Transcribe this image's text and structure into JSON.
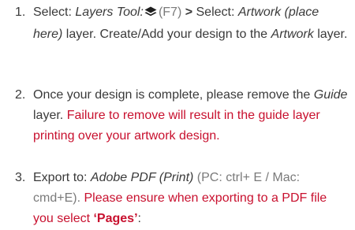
{
  "steps": [
    {
      "number": "1.",
      "select_prefix": "Select: ",
      "tool_name": "Layers Tool:",
      "icon": "layers-icon",
      "shortcut": "(F7)",
      "separator": " > ",
      "select_prefix_2": "Select: ",
      "layer_name": "Artwork (place here)",
      "text_after": " layer. Create/Add your design to the ",
      "artwork": "Artwork",
      "text_end": " layer."
    },
    {
      "number": "2.",
      "text_start": "Once your design is complete, please remove the ",
      "guide": "Guide",
      "text_mid": " layer. ",
      "warning": "Failure to remove will result in the guide layer printing over your artwork design."
    },
    {
      "number": "3.",
      "export_label": "Export to: ",
      "export_format": "Adobe PDF (Print)",
      "shortcuts": " (PC: ctrl+ E / Mac: cmd+E). ",
      "note": "Please ensure when exporting to a PDF file you select ",
      "pages": "‘Pages’",
      "colon": ":"
    }
  ],
  "colors": {
    "text": "#3a3a3a",
    "muted": "#7a7a7a",
    "accent_red": "#c8102e"
  }
}
